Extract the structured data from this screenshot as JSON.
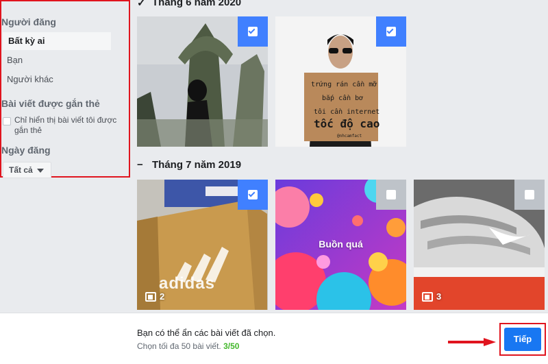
{
  "filters": {
    "poster_heading": "Người đăng",
    "poster_options": [
      "Bất kỳ ai",
      "Bạn",
      "Người khác"
    ],
    "tagged_heading": "Bài viết được gắn thẻ",
    "tagged_checkbox_label": "Chỉ hiển thị bài viết tôi được gắn thẻ",
    "date_heading": "Ngày đăng",
    "date_select_value": "Tất cả"
  },
  "groups": [
    {
      "title": "Tháng 6 năm 2020",
      "toggle": "✓"
    },
    {
      "title": "Tháng 7 năm 2019",
      "toggle": "−"
    }
  ],
  "photos": [
    {
      "selected": true
    },
    {
      "selected": true,
      "sign_lines": [
        "trứng rán cần mỡ",
        "bắp cần bơ",
        "tôi cần internet",
        "tốc độ cao"
      ],
      "sign_handle": "@nhcamfact"
    },
    {
      "selected": true,
      "count": "2",
      "brand": "adidas"
    },
    {
      "selected": false,
      "caption": "Buồn quá"
    },
    {
      "selected": false,
      "count": "3"
    }
  ],
  "footer": {
    "message": "Bạn có thể ẩn các bài viết đã chọn.",
    "limit_text": "Chọn tối đa 50 bài viết.",
    "limit_count": "3/50",
    "next_label": "Tiếp"
  },
  "colors": {
    "accent": "#1877f2",
    "select_on": "#4080ff",
    "highlight_border": "#e0141e",
    "count_green": "#42b72a"
  }
}
